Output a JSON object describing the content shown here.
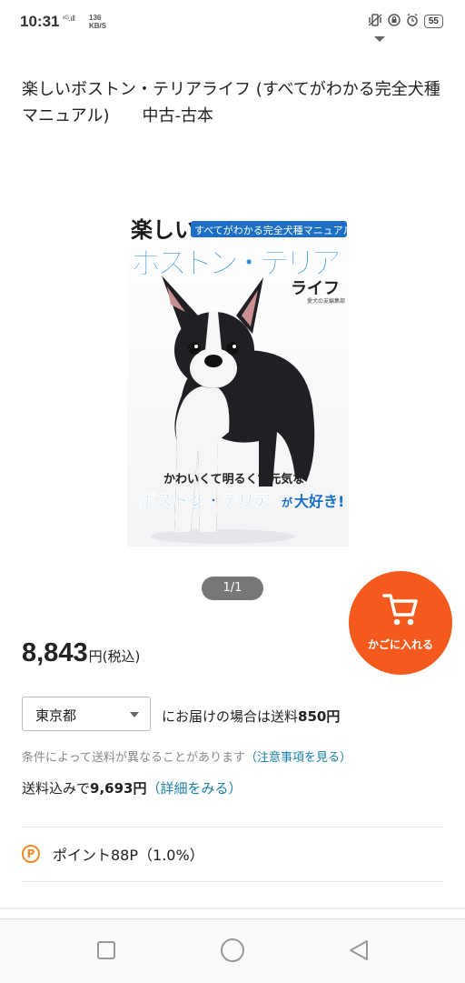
{
  "status": {
    "time": "10:31",
    "signal": "⁴ᴳ.ıll",
    "speed_value": "136",
    "speed_unit": "KB/S",
    "battery": "55",
    "icons": [
      "vibrate-icon",
      "lock-icon",
      "alarm-icon",
      "battery-icon"
    ]
  },
  "product": {
    "title": "楽しいボストン・テリアライフ (すべてがわかる完全犬種マニュアル)　　中古-古本",
    "cover": {
      "top_label": "楽しい",
      "subtitle": "すべてがわかる完全犬種マニュアル",
      "main_title": "ボストン・テリア",
      "sub_title2": "ライフ",
      "publisher_note": "愛犬の友編集部",
      "tagline": "かわいくて明るくて元気な",
      "bottom_line1": "ボストン・テリア",
      "bottom_line2": "が",
      "bottom_line3": "大好き!"
    },
    "image_counter": "1/1"
  },
  "cart": {
    "label": "かごに入れる",
    "accent": "#f45a1d"
  },
  "price": {
    "value": "8,843",
    "unit": "円",
    "tax": "(税込)"
  },
  "shipping": {
    "prefecture": "東京都",
    "text_prefix": "にお届けの場合は送料",
    "fee": "850円",
    "note": "条件によって送料が異なることがあります",
    "note_link": "（注意事項を見る）",
    "total_prefix": "送料込みで",
    "total_value": "9,693円",
    "total_link": "（詳細をみる）",
    "link_color": "#1a7fa8"
  },
  "points": {
    "icon_letter": "P",
    "label": "ポイント88P（1.0%）",
    "color": "#f08a24"
  },
  "navigation": {
    "buttons": [
      "recent-apps",
      "home",
      "back"
    ]
  }
}
